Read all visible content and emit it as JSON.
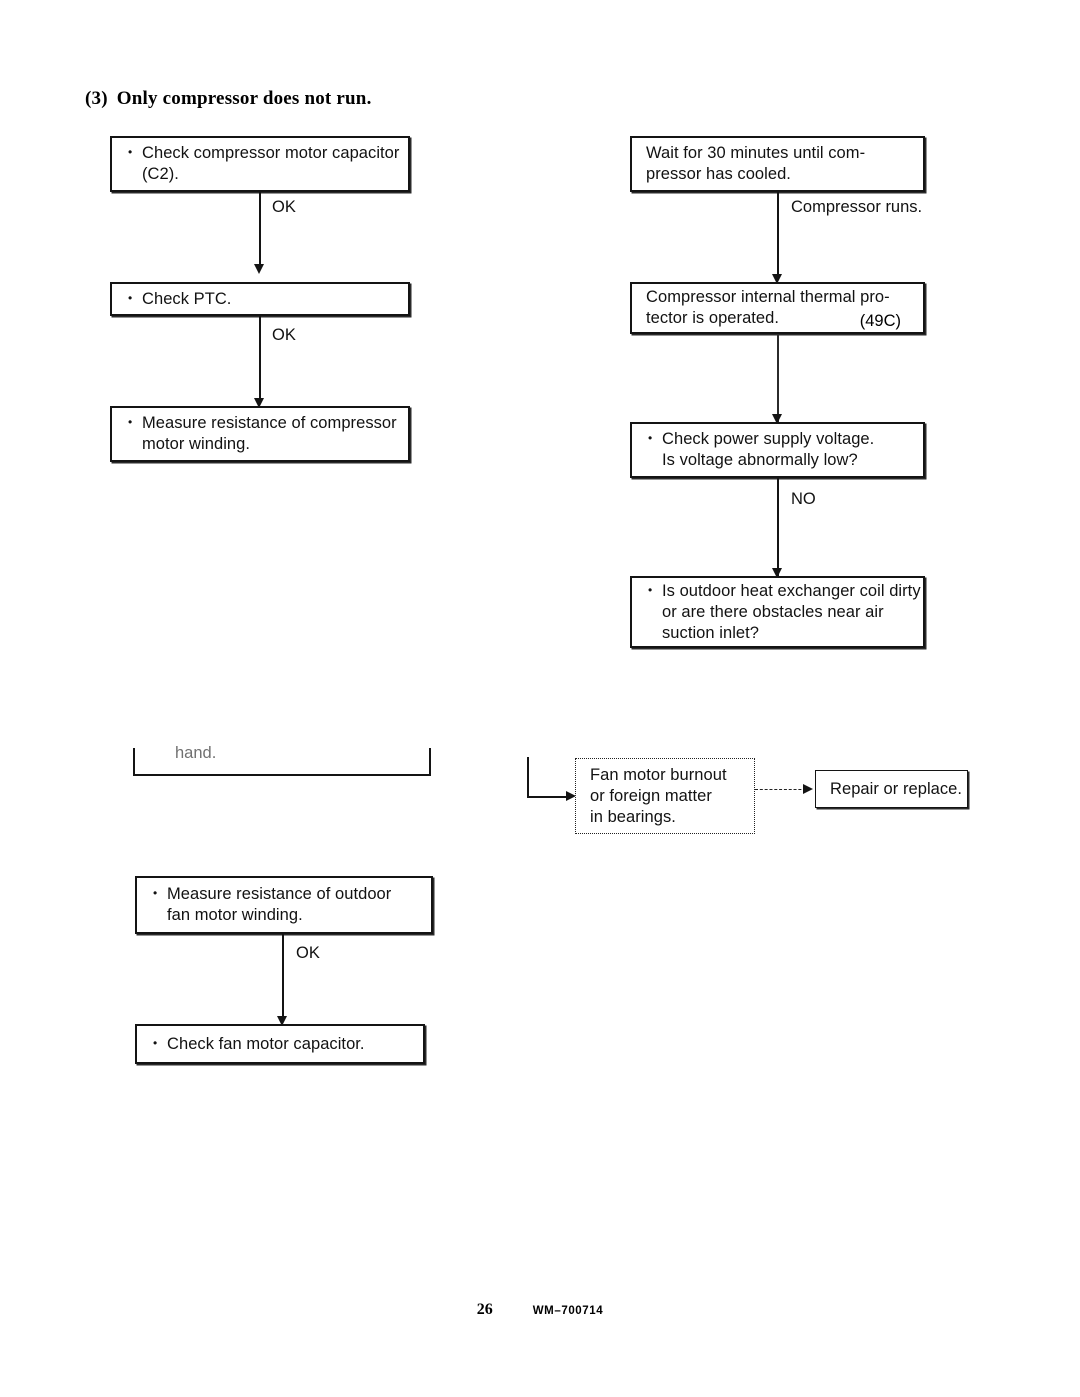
{
  "page": {
    "heading_number": "(3)",
    "heading_title": "Only compressor does not run.",
    "footer_page_number": "26",
    "footer_document_code": "WM–700714",
    "ink_color": "#141414",
    "background_color": "#ffffff"
  },
  "flow_left_compressor": {
    "boxes": [
      {
        "id": "check-compressor-motor-capacitor",
        "text": "Check compressor motor capacitor\n(C2)."
      },
      {
        "id": "check-ptc",
        "text": "Check PTC."
      },
      {
        "id": "measure-resistance-compressor-motor-winding",
        "text": "Measure resistance of compressor\nmotor winding."
      }
    ],
    "edge_labels": [
      {
        "id": "ok-1",
        "text": "OK"
      },
      {
        "id": "ok-2",
        "text": "OK"
      }
    ]
  },
  "flow_right_compressor": {
    "boxes": [
      {
        "id": "wait-30-minutes",
        "text": "Wait for 30 minutes until com-\npressor has cooled."
      },
      {
        "id": "thermal-protector-operated",
        "text": "Compressor internal thermal pro-\ntector is operated.",
        "code": "(49C)"
      },
      {
        "id": "check-power-supply-voltage",
        "text": "Check power supply voltage.\nIs voltage abnormally low?"
      },
      {
        "id": "outdoor-heat-exchanger-coil-dirty",
        "text": "Is outdoor heat exchanger coil dirty\nor are there obstacles near air\nsuction inlet?"
      }
    ],
    "edge_labels": [
      {
        "id": "compressor-runs",
        "text": "Compressor runs."
      },
      {
        "id": "no",
        "text": "NO"
      }
    ]
  },
  "flow_fan_motor": {
    "cut_box_fragment": "hand.",
    "boxes": [
      {
        "id": "fan-motor-burnout",
        "text": "Fan motor burnout\nor foreign matter\nin bearings."
      },
      {
        "id": "repair-or-replace",
        "text": "Repair or replace."
      },
      {
        "id": "measure-resistance-outdoor-fan-motor-winding",
        "text": "Measure resistance of outdoor\nfan motor winding."
      },
      {
        "id": "check-fan-motor-capacitor",
        "text": "Check fan motor capacitor."
      }
    ],
    "edge_labels": [
      {
        "id": "ok-3",
        "text": "OK"
      }
    ]
  }
}
